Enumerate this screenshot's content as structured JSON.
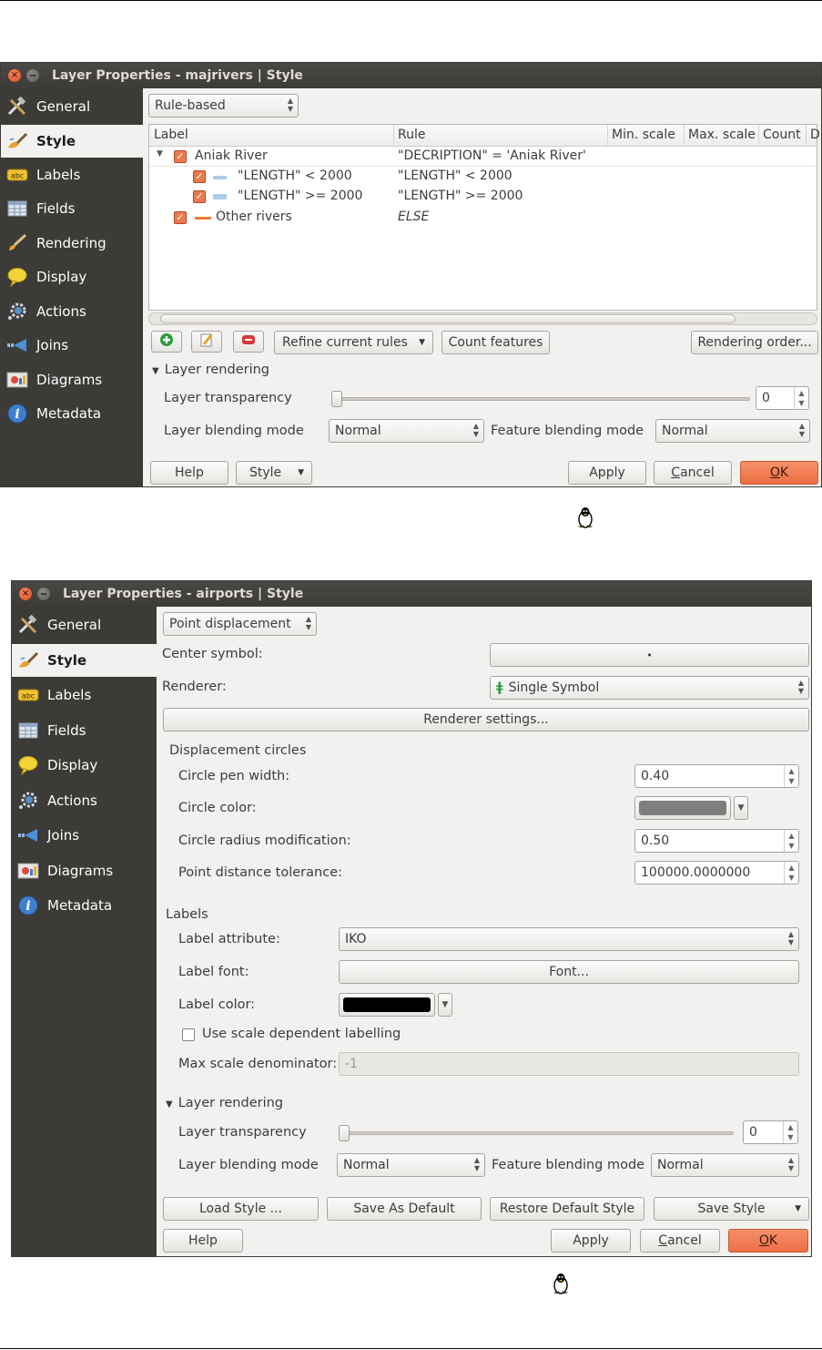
{
  "icons": {
    "general": "wrench-hammer-icon",
    "style": "paintbrush-icon",
    "labels": "abc-label-icon",
    "fields": "table-icon",
    "rendering": "brush-icon",
    "display": "speech-bubble-icon",
    "actions": "gear-icon",
    "joins": "join-arrow-icon",
    "diagrams": "diagram-icon",
    "metadata": "info-icon",
    "os": "tux-penguin-icon"
  },
  "colors": {
    "titlebar": "#3c3b37",
    "sidebar": "#3c3b37",
    "window_bg": "#f2f1f0",
    "ok_button": "#ec6e42",
    "check_accent": "#ec7a4f",
    "symbol_light_blue": "#a9cdea",
    "symbol_orange": "#f07832",
    "circle_color": "#7f7f7f",
    "label_color": "#000000"
  },
  "win1": {
    "title": "Layer Properties - majrivers | Style",
    "sidebar": [
      "General",
      "Style",
      "Labels",
      "Fields",
      "Rendering",
      "Display",
      "Actions",
      "Joins",
      "Diagrams",
      "Metadata"
    ],
    "renderer_type": "Rule-based",
    "columns": [
      "Label",
      "Rule",
      "Min. scale",
      "Max. scale",
      "Count",
      "D"
    ],
    "rows": [
      {
        "label": "Aniak River",
        "rule": "\"DECRIPTION\"  = 'Aniak River'"
      },
      {
        "label": "\"LENGTH\"  < 2000",
        "rule": "\"LENGTH\"  < 2000"
      },
      {
        "label": "\"LENGTH\" >= 2000",
        "rule": "\"LENGTH\" >= 2000"
      },
      {
        "label": "Other rivers",
        "rule": "ELSE"
      }
    ],
    "refine_btn": "Refine current rules",
    "count_btn": "Count features",
    "rendering_order_btn": "Rendering order...",
    "layer_rendering": "Layer rendering",
    "transparency_label": "Layer transparency",
    "transparency_value": "0",
    "blending_label": "Layer blending mode",
    "blending_value": "Normal",
    "feature_blending_label": "Feature blending mode",
    "feature_blending_value": "Normal",
    "help": "Help",
    "style": "Style",
    "apply": "Apply",
    "cancel_pre": "",
    "cancel_mn": "C",
    "cancel_post": "ancel",
    "ok_mn": "O",
    "ok_post": "K"
  },
  "win2": {
    "title": "Layer Properties - airports | Style",
    "sidebar": [
      "General",
      "Style",
      "Labels",
      "Fields",
      "Display",
      "Actions",
      "Joins",
      "Diagrams",
      "Metadata"
    ],
    "renderer_type": "Point displacement",
    "center_symbol_label": "Center symbol:",
    "center_symbol_value": "•",
    "renderer_label": "Renderer:",
    "renderer_value": "Single Symbol",
    "renderer_settings_btn": "Renderer settings...",
    "displacement_header": "Displacement circles",
    "circle_pen_width_label": "Circle pen width:",
    "circle_pen_width_value": "0.40",
    "circle_color_label": "Circle color:",
    "circle_radius_label": "Circle radius modification:",
    "circle_radius_value": "0.50",
    "point_tolerance_label": "Point distance tolerance:",
    "point_tolerance_value": "100000.0000000",
    "labels_header": "Labels",
    "label_attribute_label": "Label attribute:",
    "label_attribute_value": "IKO",
    "label_font_label": "Label font:",
    "label_font_btn": "Font...",
    "label_color_label": "Label color:",
    "scale_dependent_label": "Use scale dependent labelling",
    "max_scale_label": "Max scale denominator:",
    "max_scale_value": "-1",
    "layer_rendering": "Layer rendering",
    "transparency_label": "Layer transparency",
    "transparency_value": "0",
    "blending_label": "Layer blending mode",
    "blending_value": "Normal",
    "feature_blending_label": "Feature blending mode",
    "feature_blending_value": "Normal",
    "load_style": "Load Style ...",
    "save_default": "Save As Default",
    "restore_default": "Restore Default Style",
    "save_style": "Save Style",
    "help": "Help",
    "apply": "Apply",
    "cancel_mn": "C",
    "cancel_post": "ancel",
    "ok_mn": "O",
    "ok_post": "K"
  }
}
